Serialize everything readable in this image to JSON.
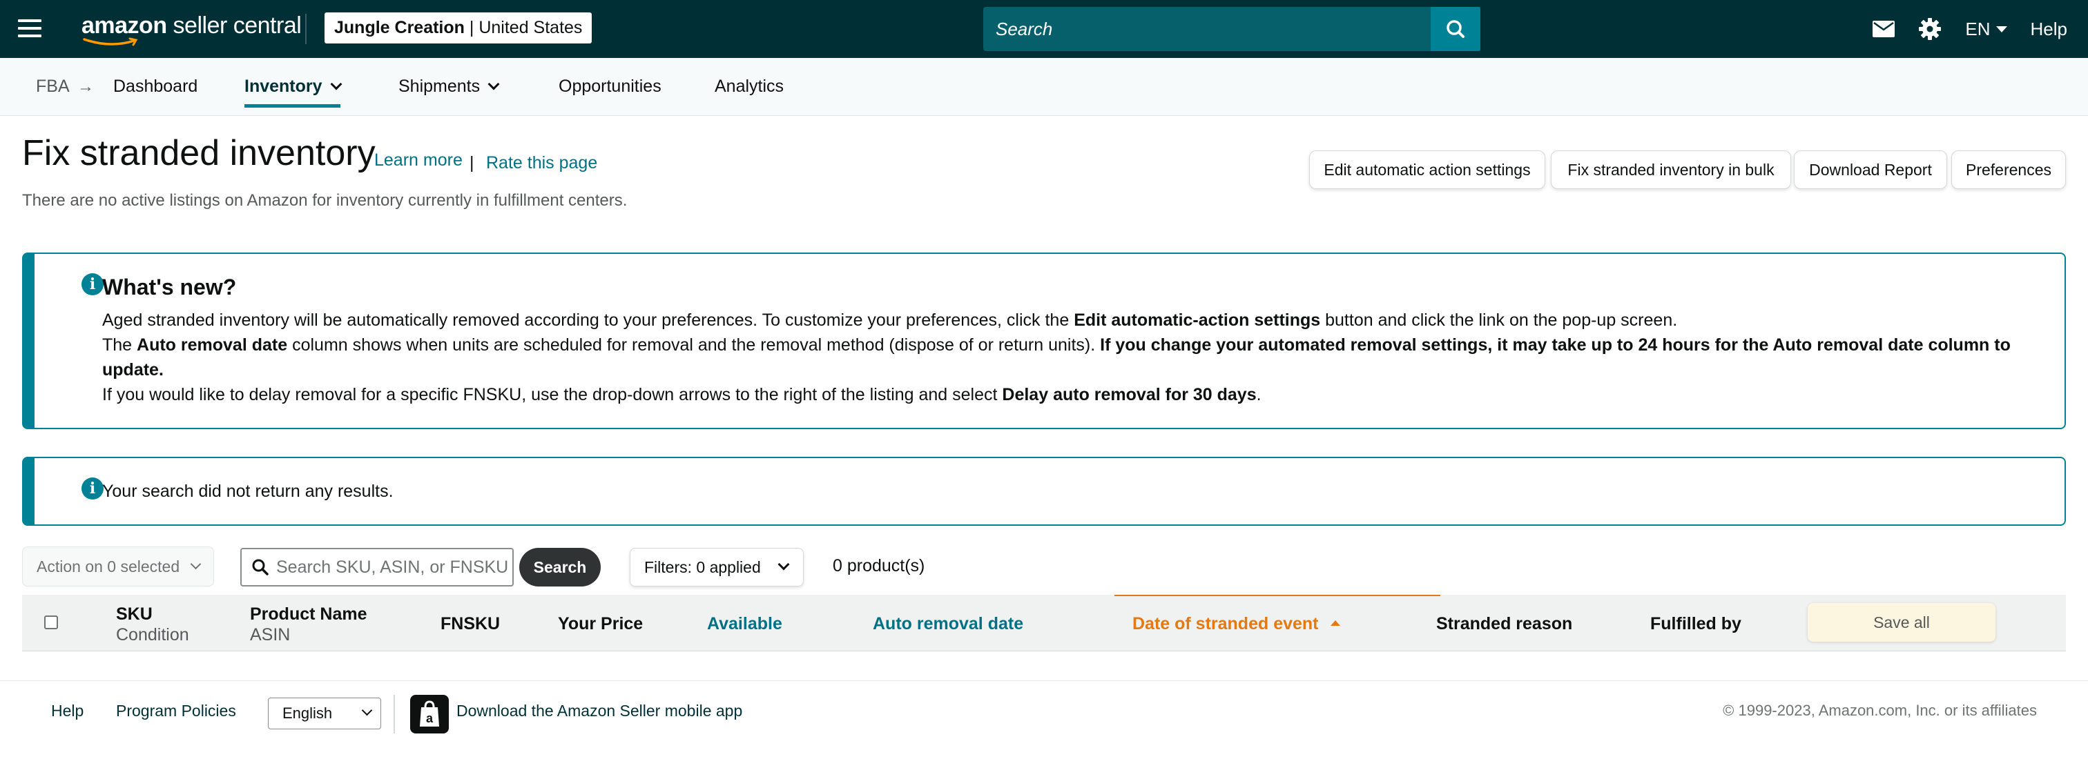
{
  "header": {
    "logo_text_bold": "amazon",
    "logo_text": "seller central",
    "account_store": "Jungle Creation",
    "account_separator": "|",
    "account_region": "United States",
    "search_placeholder": "Search",
    "language": "EN",
    "help": "Help",
    "icons": [
      "menu-icon",
      "search-icon",
      "mail-icon",
      "gear-icon",
      "caret-down-icon"
    ]
  },
  "subnav": {
    "crumb": "FBA",
    "crumb_arrow": "→",
    "items": [
      {
        "label": "Dashboard"
      },
      {
        "label": "Inventory",
        "active": true
      },
      {
        "label": "Shipments"
      },
      {
        "label": "Opportunities"
      },
      {
        "label": "Analytics"
      }
    ]
  },
  "page": {
    "title": "Fix stranded inventory",
    "learn_more": "Learn more",
    "separator": "|",
    "rate": "Rate this page",
    "subtitle": "There are no active listings on Amazon for inventory currently in fulfillment centers.",
    "buttons": [
      "Edit automatic action settings",
      "Fix stranded inventory in bulk",
      "Download Report",
      "Preferences"
    ]
  },
  "whats_new": {
    "title": "What's new?",
    "line1_a": "Aged stranded inventory will be automatically removed according to your preferences. To customize your preferences, click the ",
    "line1_b": "Edit automatic-action settings",
    "line1_c": " button and click the link on the pop-up screen.",
    "line2_a": "The ",
    "line2_b": "Auto removal date",
    "line2_c": " column shows when units are scheduled for removal and the removal method (dispose of or return units). ",
    "line2_d": "If you change your automated removal settings, it may take up to 24 hours for the Auto removal date column to update.",
    "line3_a": "If you would like to delay removal for a specific FNSKU, use the drop-down arrows to the right of the listing and select ",
    "line3_b": "Delay auto removal for 30 days",
    "line3_c": "."
  },
  "no_results": {
    "message": "Your search did not return any results."
  },
  "toolbar": {
    "action": "Action on 0 selected",
    "search_placeholder": "Search SKU, ASIN, or FNSKU",
    "search_button": "Search",
    "filters": "Filters: 0 applied",
    "count": "0 product(s)"
  },
  "table": {
    "columns": {
      "sku": "SKU",
      "condition": "Condition",
      "product_name": "Product Name",
      "asin": "ASIN",
      "fnsku": "FNSKU",
      "price": "Your Price",
      "available": "Available",
      "auto_removal": "Auto removal date",
      "stranded_date": "Date of stranded event",
      "reason": "Stranded reason",
      "fulfilled": "Fulfilled by"
    },
    "sorted_column": "Date of stranded event",
    "sort_direction": "ascending",
    "save_all": "Save all",
    "rows": []
  },
  "footer": {
    "help": "Help",
    "policies": "Program Policies",
    "language": "English",
    "app": "Download the Amazon Seller mobile app",
    "copyright": "© 1999-2023, Amazon.com, Inc. or its affiliates"
  },
  "colors": {
    "topbar": "#002f36",
    "accent": "#008296",
    "link": "#007185",
    "sort_active": "#e47911",
    "save_all_bg": "#fcf5e0"
  }
}
